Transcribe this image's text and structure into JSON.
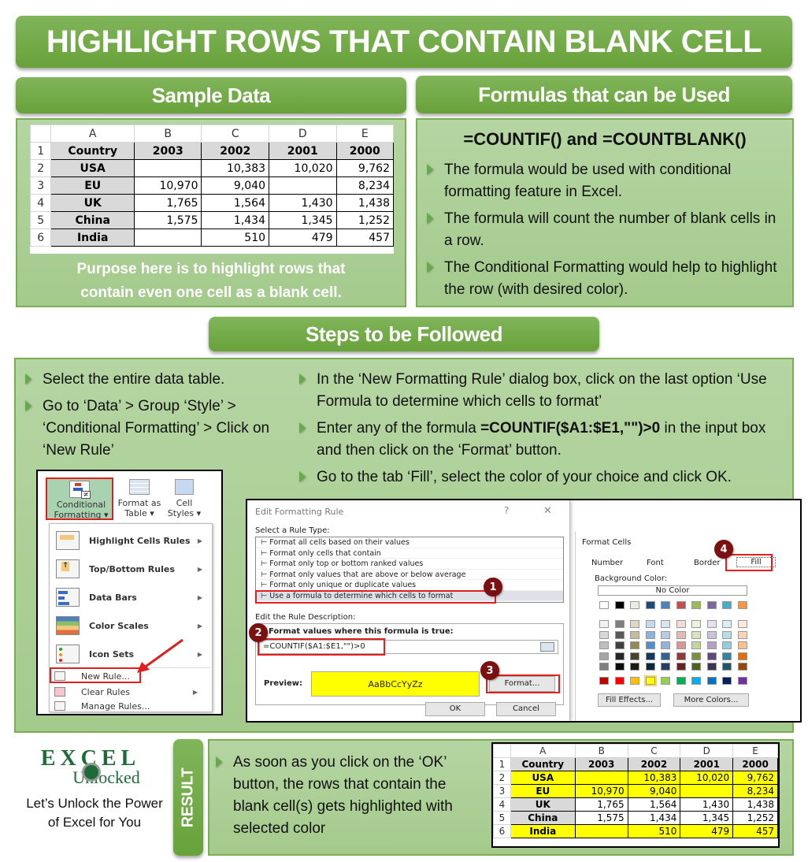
{
  "title": "HIGHLIGHT ROWS THAT CONTAIN BLANK CELL",
  "sample": {
    "heading": "Sample Data",
    "columns": [
      "A",
      "B",
      "C",
      "D",
      "E"
    ],
    "header_row": [
      "Country",
      "2003",
      "2002",
      "2001",
      "2000"
    ],
    "rows": [
      {
        "n": "2",
        "cells": [
          "USA",
          "",
          "10,383",
          "10,020",
          "9,762"
        ]
      },
      {
        "n": "3",
        "cells": [
          "EU",
          "10,970",
          "9,040",
          "",
          "8,234"
        ]
      },
      {
        "n": "4",
        "cells": [
          "UK",
          "1,765",
          "1,564",
          "1,430",
          "1,438"
        ]
      },
      {
        "n": "5",
        "cells": [
          "China",
          "1,575",
          "1,434",
          "1,345",
          "1,252"
        ]
      },
      {
        "n": "6",
        "cells": [
          "India",
          "",
          "510",
          "479",
          "457"
        ]
      }
    ],
    "caption_line1": "Purpose here is to highlight rows that",
    "caption_line2": "contain even one cell as a blank cell."
  },
  "formulas": {
    "heading": "Formulas that can be Used",
    "subheading": "=COUNTIF() and =COUNTBLANK()",
    "bullets": [
      "The formula would be used with conditional formatting feature in Excel.",
      "The formula will count the number of blank cells in a row.",
      "The Conditional Formatting would help to highlight the row (with desired color)."
    ]
  },
  "steps": {
    "heading": "Steps to be Followed",
    "left_bullets": [
      "Select the entire data table.",
      "Go to ‘Data’ > Group ‘Style’ > ‘Conditional Formatting’ > Click on ‘New Rule’"
    ],
    "right_bullet1": "In the ‘New Formatting Rule’ dialog box, click on the last option ‘Use Formula to determine which cells to format’",
    "right_bullet2_pre": "Enter any of the formula ",
    "right_bullet2_formula": "=COUNTIF($A1:$E1,\"\")>0",
    "right_bullet2_post": " in the input box and then click on the ‘Format’ button.",
    "right_bullet3": "Go to the tab ‘Fill’, select the color of your choice and click OK."
  },
  "ribbon": {
    "cf_line1": "Conditional",
    "cf_line2": "Formatting ▾",
    "fat_line1": "Format as",
    "fat_line2": "Table ▾",
    "cs_line1": "Cell",
    "cs_line2": "Styles ▾",
    "menu_items": [
      "Highlight Cells Rules",
      "Top/Bottom Rules",
      "Data Bars",
      "Color Scales",
      "Icon Sets"
    ],
    "small_items": [
      "New Rule...",
      "Clear Rules",
      "Manage Rules..."
    ]
  },
  "dialog": {
    "title": "Edit Formatting Rule",
    "help": "?",
    "close": "✕",
    "select_label": "Select a Rule Type:",
    "rule_types": [
      "Format all cells based on their values",
      "Format only cells that contain",
      "Format only top or bottom ranked values",
      "Format only values that are above or below average",
      "Format only unique or duplicate values",
      "Use a formula to determine which cells to format"
    ],
    "edit_label": "Edit the Rule Description:",
    "formula_label": "Format values where this formula is true:",
    "formula_value": "=COUNTIF($A1:$E1,\"\")>0",
    "preview_label": "Preview:",
    "preview_text": "AaBbCcYyZz",
    "format_button": "Format...",
    "ok": "OK",
    "cancel": "Cancel"
  },
  "format_cells": {
    "title": "Format Cells",
    "tabs": [
      "Number",
      "Font",
      "Border",
      "Fill"
    ],
    "bg_label": "Background Color:",
    "no_color": "No Color",
    "fill_effects": "Fill Effects...",
    "more_colors": "More Colors...",
    "theme_row": [
      "#ffffff",
      "#000000",
      "#eeece1",
      "#1f497d",
      "#4f81bd",
      "#c0504d",
      "#9bbb59",
      "#8064a2",
      "#4bacc6",
      "#f79646"
    ],
    "tint_rows": [
      [
        "#f2f2f2",
        "#7f7f7f",
        "#ddd9c3",
        "#c6d9f0",
        "#dbe5f1",
        "#f2dcdb",
        "#ebf1dd",
        "#e5e0ec",
        "#dbeef3",
        "#fdeada"
      ],
      [
        "#d8d8d8",
        "#595959",
        "#c4bd97",
        "#8db3e2",
        "#b8cce4",
        "#e5b9b7",
        "#d7e3bc",
        "#ccc1d9",
        "#b7dde8",
        "#fbd5b5"
      ],
      [
        "#bfbfbf",
        "#3f3f3f",
        "#938953",
        "#548dd4",
        "#95b3d7",
        "#d99694",
        "#c3d69b",
        "#b2a2c7",
        "#92cddc",
        "#fac08f"
      ],
      [
        "#a5a5a5",
        "#262626",
        "#494429",
        "#17365d",
        "#366092",
        "#953734",
        "#76923c",
        "#5f497a",
        "#31859b",
        "#e36c09"
      ],
      [
        "#7f7f7f",
        "#0c0c0c",
        "#1d1b10",
        "#0f243e",
        "#244061",
        "#632423",
        "#4f6128",
        "#3f3151",
        "#205867",
        "#974806"
      ]
    ],
    "standard_row": [
      "#c00000",
      "#ff0000",
      "#ffc000",
      "#ffff00",
      "#92d050",
      "#00b050",
      "#00b0f0",
      "#0070c0",
      "#002060",
      "#7030a0"
    ]
  },
  "badges": [
    "1",
    "2",
    "3",
    "4"
  ],
  "result": {
    "label": "RESULT",
    "text": "As soon as you click on the ‘OK’ button, the rows that contain the blank cell(s) gets highlighted with selected color",
    "highlight_color": "#ffff00",
    "highlighted_rows": [
      "2",
      "3",
      "6"
    ]
  },
  "logo": {
    "line1": "EXCEL",
    "line2": "Unlocked",
    "tagline": "Let’s Unlock the Power of Excel for You"
  },
  "colors": {
    "banner_green": "#6aa83e",
    "panel_green": "#acd095",
    "highlight": "#ffff00",
    "badge": "#7a1010",
    "callout_red": "#e02020"
  }
}
